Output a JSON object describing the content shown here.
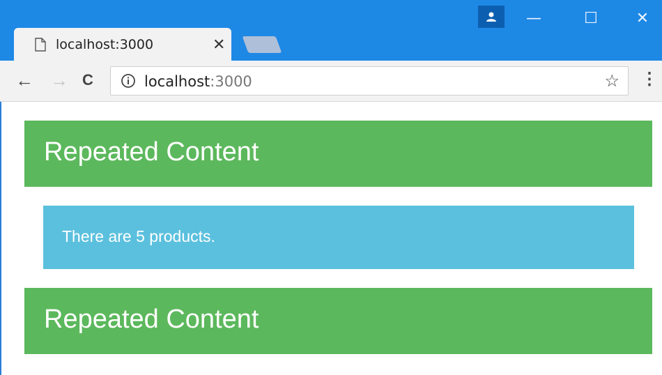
{
  "browser": {
    "tab_title": "localhost:3000",
    "close_glyph": "✕",
    "window": {
      "minimize": "—",
      "maximize": "☐",
      "close": "✕"
    },
    "nav": {
      "back": "←",
      "forward": "→",
      "reload": "C"
    },
    "address": {
      "host": "localhost",
      "port": ":3000"
    },
    "star_glyph": "☆",
    "menu_glyph": "⋮"
  },
  "page": {
    "heading_1": "Repeated Content",
    "message": "There are 5 products.",
    "heading_2": "Repeated Content"
  },
  "colors": {
    "titlebar": "#1e88e5",
    "heading_bg": "#5cb85c",
    "info_bg": "#5bc0de"
  }
}
